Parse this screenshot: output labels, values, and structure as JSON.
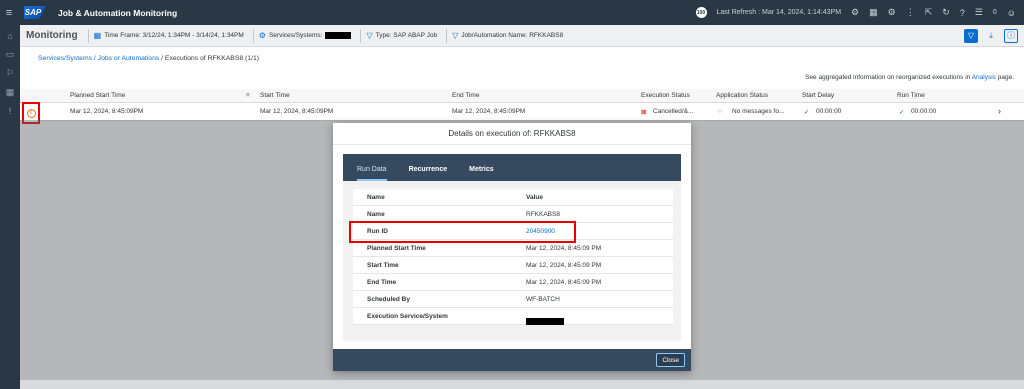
{
  "shell": {
    "logo": "SAP",
    "title": "Job & Automation Monitoring",
    "refresh_badge": "100",
    "last_refresh": "Last Refresh : Mar 14, 2024, 1:14:43PM",
    "notif_count": "0"
  },
  "toolbar": {
    "title": "Monitoring",
    "timeframe": "Time Frame: 3/12/24, 1:34PM - 3/14/24, 1:34PM",
    "services": "Services/Systems:",
    "type": "Type: SAP ABAP Job",
    "name": "Job/Automation Name: RFKKABS8"
  },
  "breadcrumb": {
    "link": "Services/Systems / Jobs or Automations",
    "current": " / Executions of RFKKABS8 (1/1)"
  },
  "info_line": {
    "prefix": "See aggregated information on reorganized executions in ",
    "link": "Analysis",
    "suffix": " page."
  },
  "table": {
    "headers": [
      "Planned Start Time",
      "Start Time",
      "End Time",
      "Execution Status",
      "Application Status",
      "Start Delay",
      "Run Time"
    ],
    "row": {
      "planned_start": "Mar 12, 2024, 8:45:09PM",
      "start": "Mar 12, 2024, 8:45:09PM",
      "end": "Mar 12, 2024, 8:45:09PM",
      "exec_status": "Cancelled/&...",
      "app_status": "No messages fo...",
      "start_delay": "00:00:00",
      "run_time": "00:00:00"
    }
  },
  "dialog": {
    "title": "Details on execution of: RFKKABS8",
    "tabs": [
      "Run Data",
      "Recurrence",
      "Metrics"
    ],
    "col_name": "Name",
    "col_value": "Value",
    "rows": [
      {
        "k": "Name",
        "v": "RFKKABS8"
      },
      {
        "k": "Run ID",
        "v": "20450900"
      },
      {
        "k": "Planned Start Time",
        "v": "Mar 12, 2024, 8:45:09 PM"
      },
      {
        "k": "Start Time",
        "v": "Mar 12, 2024, 8:45:09 PM"
      },
      {
        "k": "End Time",
        "v": "Mar 12, 2024, 8:45:09 PM"
      },
      {
        "k": "Scheduled By",
        "v": "WF-BATCH"
      },
      {
        "k": "Execution Service/System",
        "v": ""
      }
    ],
    "close": "Close"
  }
}
